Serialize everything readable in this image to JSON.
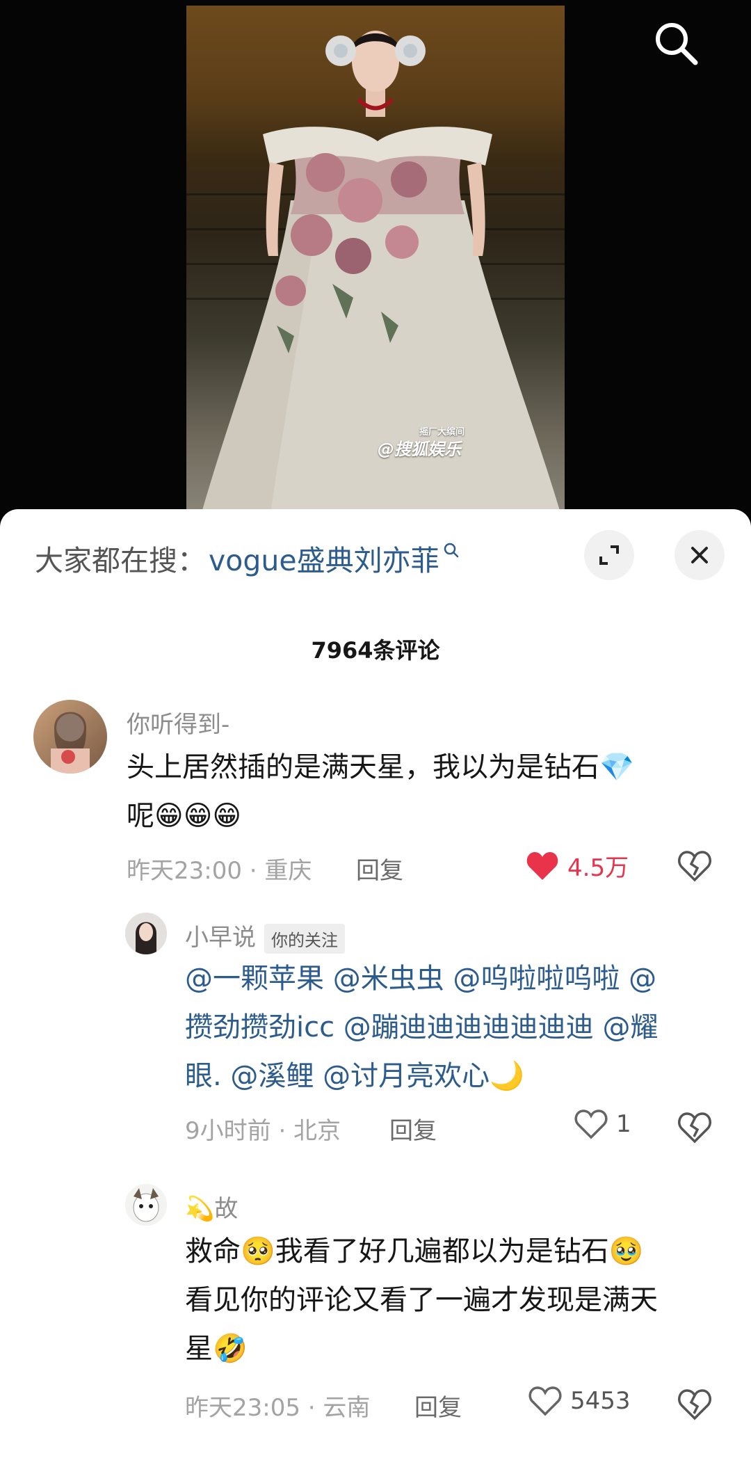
{
  "video": {
    "watermark_small": "摇厂大缤间",
    "watermark": "@搜狐娱乐"
  },
  "search_bar": {
    "prefix": "大家都在搜：",
    "term": "vogue盛典刘亦菲"
  },
  "comments_header": {
    "count_text": "7964条评论"
  },
  "comments": [
    {
      "user": "你听得到-",
      "text_line1": "头上居然插的是满天星，我以为是钻石💎",
      "text_line2": "呢😁😁😁",
      "time_location": "昨天23:00 · 重庆",
      "reply_label": "回复",
      "likes": "4.5万",
      "liked": true
    },
    {
      "user": "小早说",
      "tag": "你的关注",
      "text_line1": "@一颗苹果 @米虫虫 @呜啦啦呜啦 @",
      "text_line2": "攒劲攒劲icc @蹦迪迪迪迪迪迪迪 @耀",
      "text_line3": "眼. @溪鲤 @讨月亮欢心🌙",
      "time_location": "9小时前 · 北京",
      "reply_label": "回复",
      "likes": "1"
    },
    {
      "user": "💫故",
      "text_line1": "救命🥺我看了好几遍都以为是钻石🥹",
      "text_line2": "看见你的评论又看了一遍才发现是满天",
      "text_line3": "星🤣",
      "time_location": "昨天23:05 · 云南",
      "reply_label": "回复",
      "likes": "5453"
    }
  ],
  "colors": {
    "mention": "#2c5b8e",
    "like_active": "#e8334a"
  }
}
